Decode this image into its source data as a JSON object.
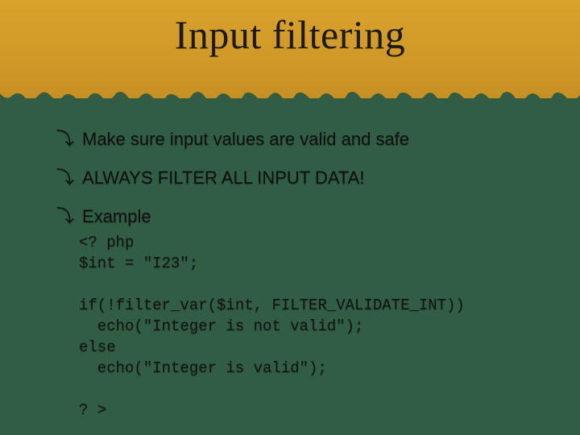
{
  "slide": {
    "title": "Input filtering",
    "bullets": [
      "Make sure input values are valid and safe",
      "ALWAYS FILTER ALL INPUT DATA!",
      "Example"
    ],
    "bullet_glyph": "⤵",
    "code": "<? php\n$int = \"I23\";\n\nif(!filter_var($int, FILTER_VALIDATE_INT))\n  echo(\"Integer is not valid\");\nelse\n  echo(\"Integer is valid\");\n\n? >"
  },
  "colors": {
    "top_band": "#d9a22b",
    "background": "#315d44"
  }
}
